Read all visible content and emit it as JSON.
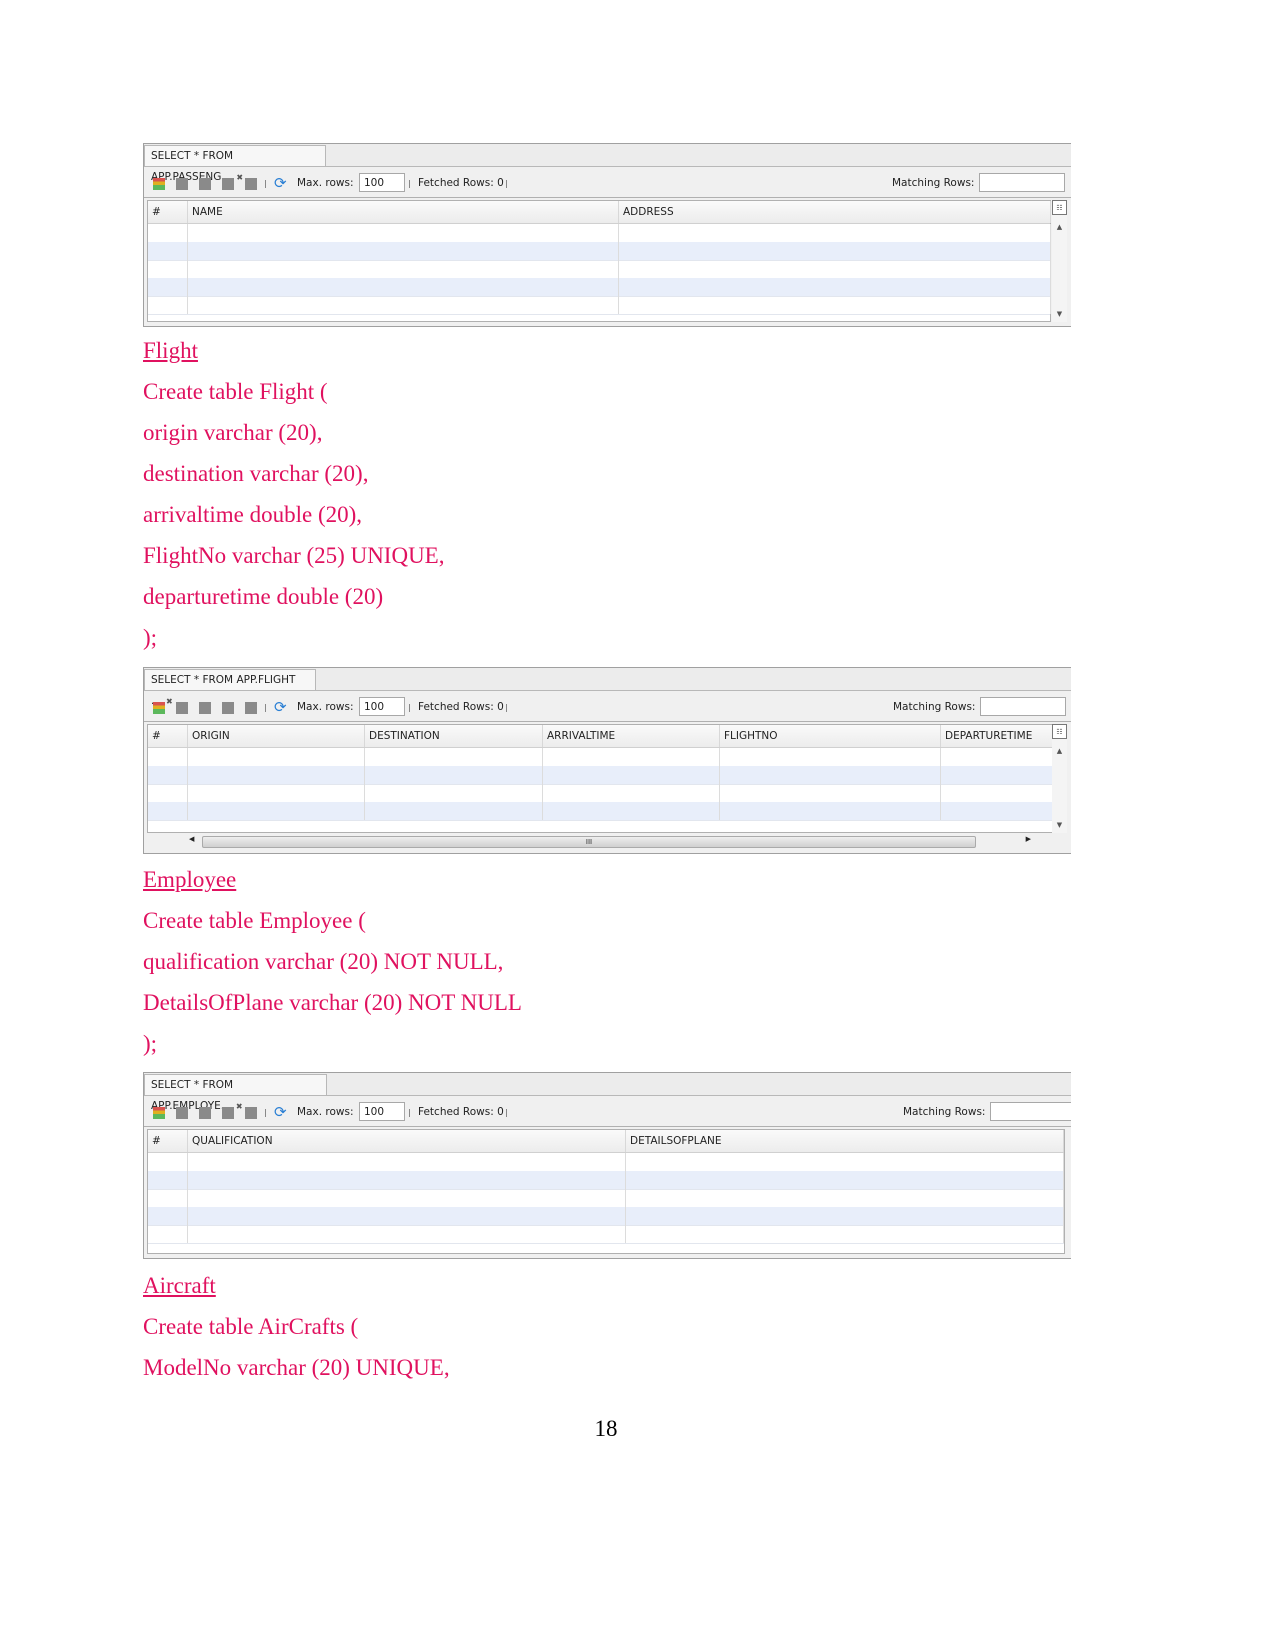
{
  "colors": {
    "text": "#e0115f",
    "row_alt": "#e8eefa"
  },
  "panels": [
    {
      "tab": "SELECT * FROM APP.PASSENG...",
      "max_rows_label": "Max. rows:",
      "max_rows": "100",
      "fetched": "Fetched Rows: 0",
      "matching": "Matching Rows:",
      "matching_value": "",
      "columns": [
        "#",
        "NAME",
        "ADDRESS"
      ],
      "hscroll": false,
      "hscroll_grip": ""
    },
    {
      "tab": "SELECT * FROM APP.FLIGHT ...",
      "max_rows_label": "Max. rows:",
      "max_rows": "100",
      "fetched": "Fetched Rows: 0",
      "matching": "Matching Rows:",
      "matching_value": "",
      "columns": [
        "#",
        "ORIGIN",
        "DESTINATION",
        "ARRIVALTIME",
        "FLIGHTNO",
        "DEPARTURETIME"
      ],
      "hscroll": true,
      "hscroll_grip": "III"
    },
    {
      "tab": "SELECT * FROM APP.EMPLOYE...",
      "max_rows_label": "Max. rows:",
      "max_rows": "100",
      "fetched": "Fetched Rows: 0",
      "matching": "Matching Rows:",
      "matching_value": "",
      "columns": [
        "#",
        "QUALIFICATION",
        "DETAILSOFPLANE"
      ],
      "hscroll": false,
      "hscroll_grip": ""
    }
  ],
  "sections": {
    "flight": {
      "heading": "Flight",
      "lines": [
        "Create table Flight (",
        "origin varchar (20),",
        "destination varchar (20),",
        "arrivaltime double (20),",
        "FlightNo varchar (25) UNIQUE,",
        "departuretime double (20)",
        ");"
      ]
    },
    "employee": {
      "heading": "Employee",
      "lines": [
        "Create table Employee (",
        "qualification varchar (20) NOT NULL,",
        "DetailsOfPlane varchar (20) NOT NULL",
        ");"
      ]
    },
    "aircraft": {
      "heading": "Aircraft",
      "lines": [
        "Create table AirCrafts (",
        "ModelNo varchar (20) UNIQUE,"
      ]
    }
  },
  "page_number": "18"
}
